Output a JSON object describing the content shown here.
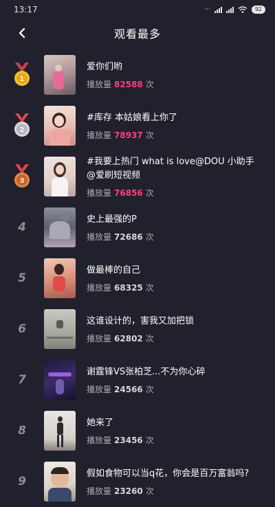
{
  "status": {
    "time": "13:17",
    "battery": "92"
  },
  "header": {
    "title": "观看最多"
  },
  "play_label": "播放量",
  "play_unit": "次",
  "colors": {
    "background": "#20212c",
    "hot_number": "#ff3f7e",
    "gold": "#e6b422",
    "silver": "#c0c0c8",
    "bronze": "#cd7a3b"
  },
  "items": [
    {
      "rank": "1",
      "title": "爱你们哟",
      "plays": "82588",
      "medal": "gold-medal-icon"
    },
    {
      "rank": "2",
      "title": "#库存 本姑娘看上你了",
      "plays": "78937",
      "medal": "silver-medal-icon"
    },
    {
      "rank": "3",
      "title": "#我要上热门 what is love@DOU 小助手 @爱刷短视频",
      "plays": "76856",
      "medal": "bronze-medal-icon"
    },
    {
      "rank": "4",
      "title": "史上最强的P",
      "plays": "72686"
    },
    {
      "rank": "5",
      "title": "做最棒的自己",
      "plays": "68325"
    },
    {
      "rank": "6",
      "title": "这谁设计的，害我又加把锁",
      "plays": "62802"
    },
    {
      "rank": "7",
      "title": "谢霆锋VS张柏芝...不为你心碎",
      "plays": "24566"
    },
    {
      "rank": "8",
      "title": "她来了",
      "plays": "23456"
    },
    {
      "rank": "9",
      "title": "假如食物可以当q花，你会是百万富翁吗?",
      "plays": "23260"
    }
  ]
}
